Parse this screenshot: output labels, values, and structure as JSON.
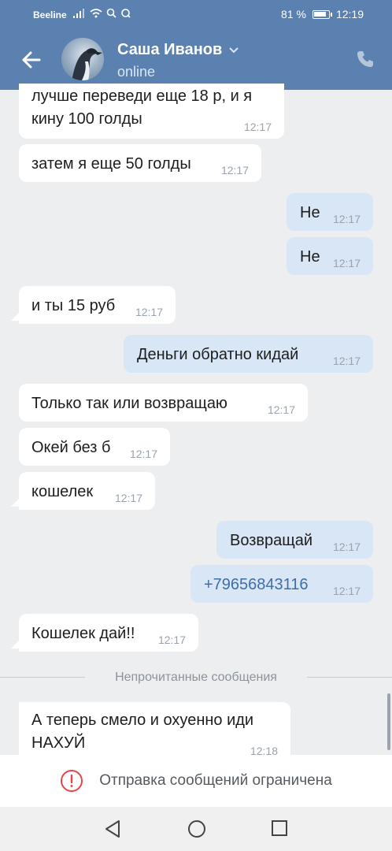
{
  "status_bar": {
    "carrier": "Beeline",
    "battery": "81 %",
    "time": "12:19"
  },
  "header": {
    "contact_name": "Саша Иванов",
    "presence": "online"
  },
  "messages": [
    {
      "dir": "in",
      "lines": [
        "лучше переведи еще 18 р, и я",
        "кину 100 голды"
      ],
      "time": "12:17"
    },
    {
      "dir": "in",
      "lines": [
        "затем я еще 50 голды"
      ],
      "time": "12:17"
    },
    {
      "dir": "out",
      "lines": [
        "Не"
      ],
      "time": "12:17"
    },
    {
      "dir": "out",
      "lines": [
        "Не"
      ],
      "time": "12:17"
    },
    {
      "dir": "in",
      "lines": [
        "и ты 15 руб"
      ],
      "time": "12:17"
    },
    {
      "dir": "out",
      "lines": [
        "Деньги обратно кидай"
      ],
      "time": "12:17"
    },
    {
      "dir": "in",
      "lines": [
        "Только так или возвращаю"
      ],
      "time": "12:17"
    },
    {
      "dir": "in",
      "lines": [
        "Окей без б"
      ],
      "time": "12:17"
    },
    {
      "dir": "in",
      "lines": [
        "кошелек"
      ],
      "time": "12:17"
    },
    {
      "dir": "out",
      "lines": [
        "Возвращай"
      ],
      "time": "12:17"
    },
    {
      "dir": "out",
      "lines": [
        "+79656843116"
      ],
      "time": "12:17",
      "link": true
    },
    {
      "dir": "in",
      "lines": [
        "Кошелек дай!!"
      ],
      "time": "12:17"
    },
    {
      "dir": "in",
      "lines": [
        "А теперь смело и охуенно иди",
        "НАХУЙ"
      ],
      "time": "12:18"
    }
  ],
  "unread_divider": "Непрочитанные сообщения",
  "restriction_banner": "Отправка сообщений ограничена",
  "colors": {
    "header": "#5b81b0",
    "incoming": "#ffffff",
    "outgoing": "#d8e6f5",
    "background": "#edeef0",
    "link": "#3f6ea7",
    "warning": "#e64646"
  }
}
